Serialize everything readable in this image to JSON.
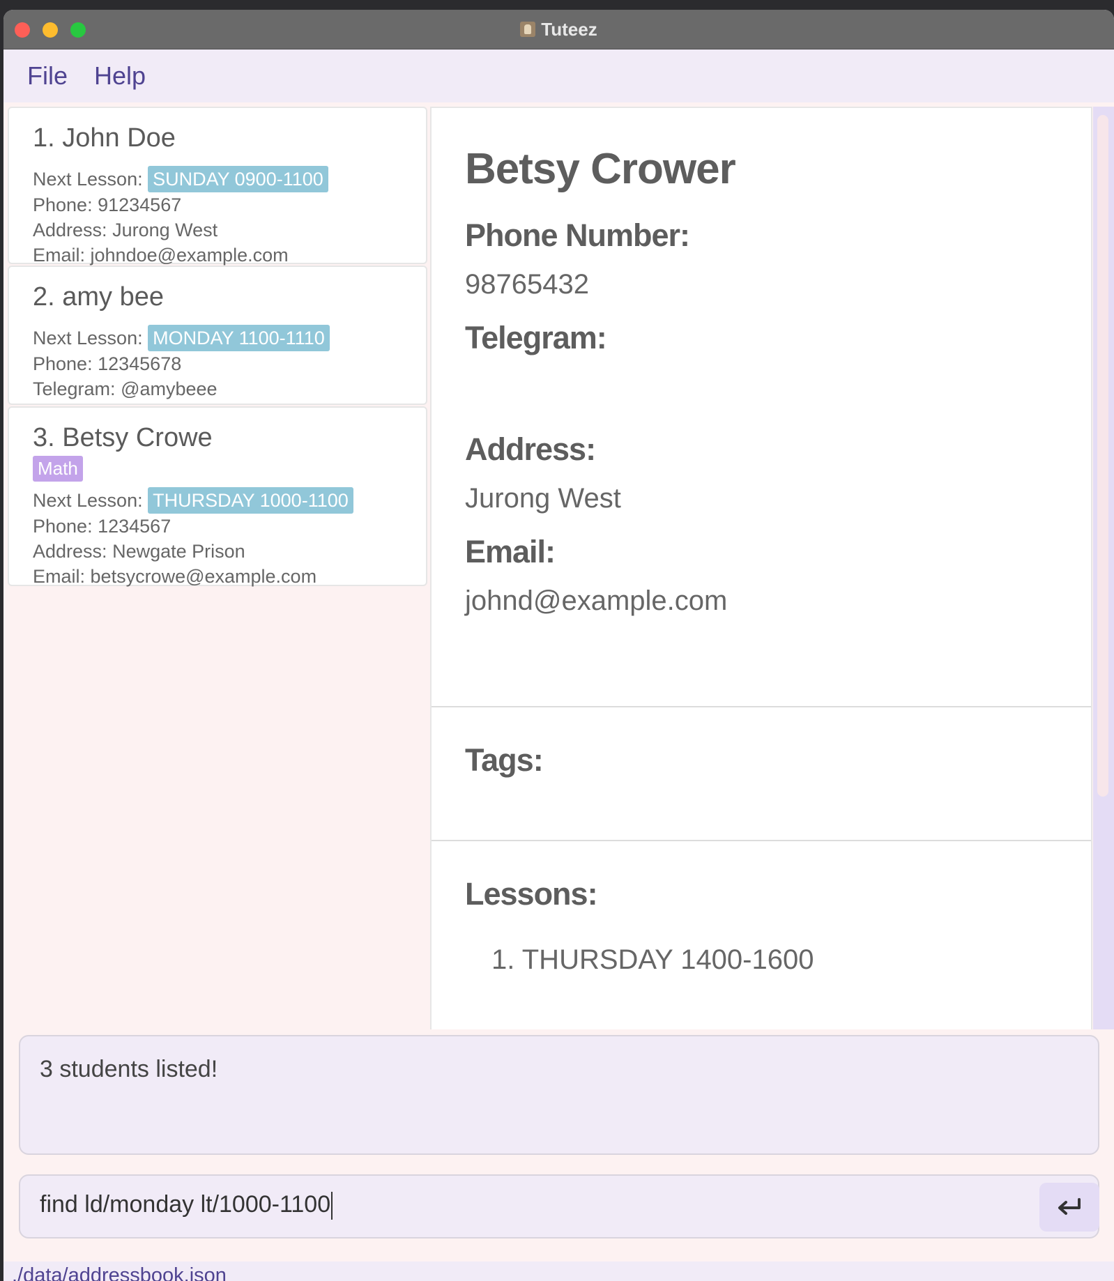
{
  "window": {
    "title": "Tuteez"
  },
  "menu": {
    "file": "File",
    "help": "Help"
  },
  "students": [
    {
      "name": "1. John Doe",
      "next_lesson_label": "Next Lesson:",
      "next_lesson": "SUNDAY 0900-1100",
      "phone_label": "Phone:",
      "phone": "91234567",
      "address_label": "Address:",
      "address": "Jurong West",
      "email_label": "Email:",
      "email": "johndoe@example.com"
    },
    {
      "name": "2. amy bee",
      "next_lesson_label": "Next Lesson:",
      "next_lesson": "MONDAY 1100-1110",
      "phone_label": "Phone:",
      "phone": "12345678",
      "telegram_label": "Telegram:",
      "telegram": "@amybeee"
    },
    {
      "name": "3. Betsy Crowe",
      "tag": "Math",
      "next_lesson_label": "Next Lesson:",
      "next_lesson": "THURSDAY 1000-1100",
      "phone_label": "Phone:",
      "phone": "1234567",
      "address_label": "Address:",
      "address": "Newgate Prison",
      "email_label": "Email:",
      "email": "betsycrowe@example.com"
    }
  ],
  "detail": {
    "name": "Betsy Crower",
    "phone_label": "Phone Number:",
    "phone": "98765432",
    "telegram_label": "Telegram:",
    "telegram": "",
    "address_label": "Address:",
    "address": "Jurong West",
    "email_label": "Email:",
    "email": "johnd@example.com",
    "tags_label": "Tags:",
    "lessons_label": "Lessons:",
    "lessons": [
      "1. THURSDAY 1400-1600"
    ]
  },
  "result": {
    "text": "3 students listed!"
  },
  "command": {
    "value": "find ld/monday lt/1000-1100"
  },
  "status": {
    "path": "./data/addressbook.json"
  },
  "colors": {
    "accent_purple": "#4f4391",
    "lesson_badge": "#91c7d9",
    "tag_badge": "#c3a3ea",
    "panel_bg": "#fdf2f2",
    "menu_bg": "#f1ebf7"
  }
}
